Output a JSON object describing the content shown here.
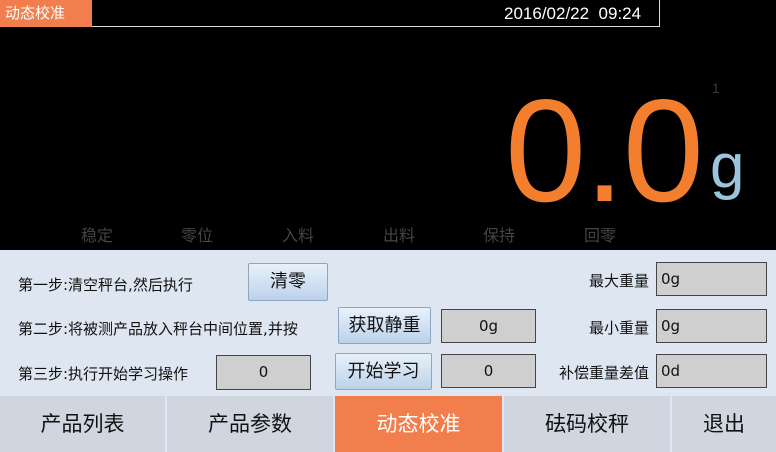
{
  "header": {
    "title": "动态校准",
    "datetime": "2016/02/22  09:24"
  },
  "scale": {
    "division_index": "1",
    "weight": "0.0",
    "unit": "g"
  },
  "status_indicators": [
    "稳定",
    "零位",
    "入料",
    "出料",
    "保持",
    "回零"
  ],
  "steps": {
    "step1": {
      "label": "第一步:清空秤台,然后执行",
      "button": "清零"
    },
    "step2": {
      "label": "第二步:将被测产品放入秤台中间位置,并按",
      "button": "获取静重",
      "value": "0g"
    },
    "step3": {
      "label": "第三步:执行开始学习操作",
      "input_value": "0",
      "button": "开始学习",
      "value": "0"
    }
  },
  "stats": {
    "max_label": "最大重量",
    "max_value": "0g",
    "min_label": "最小重量",
    "min_value": "0g",
    "diff_label": "补偿重量差值",
    "diff_value": "0d"
  },
  "nav": {
    "tabs": [
      "产品列表",
      "产品参数",
      "动态校准",
      "砝码校秤",
      "退出"
    ],
    "active": "动态校准"
  },
  "colors": {
    "accent": "#f27e4d",
    "weight": "#f27e2e",
    "unit": "#9cc4dc",
    "panel": "#dde6f1"
  }
}
